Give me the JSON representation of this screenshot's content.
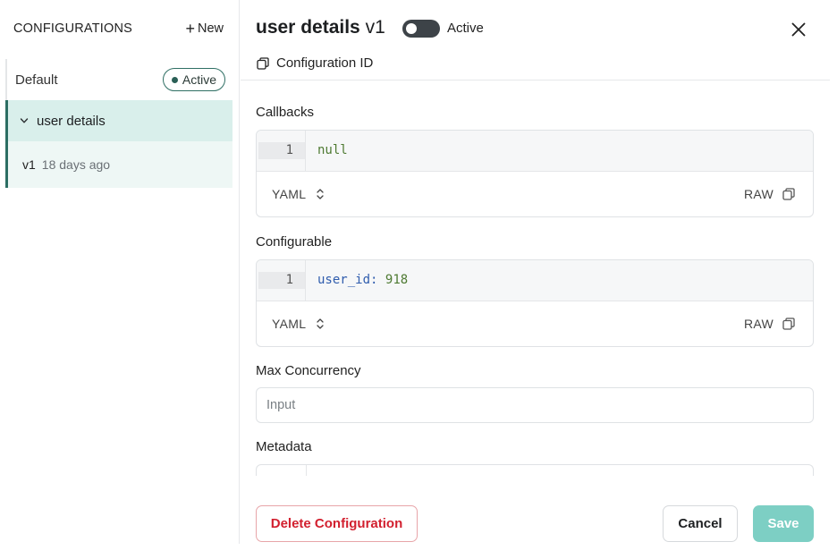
{
  "sidebar": {
    "title": "CONFIGURATIONS",
    "new_label": "New",
    "default_label": "Default",
    "default_badge": "Active",
    "selected_label": "user details",
    "version_label": "v1",
    "version_age": "18 days ago"
  },
  "header": {
    "title": "user details",
    "version": "v1",
    "toggle_label": "Active",
    "config_id_label": "Configuration ID"
  },
  "sections": {
    "callbacks": {
      "label": "Callbacks",
      "line_number": "1",
      "code_value": "null",
      "format": "YAML",
      "raw_label": "RAW"
    },
    "configurable": {
      "label": "Configurable",
      "line_number": "1",
      "code_key": "user_id",
      "code_colon": ":",
      "code_value": "918",
      "format": "YAML",
      "raw_label": "RAW"
    },
    "max_concurrency": {
      "label": "Max Concurrency",
      "placeholder": "Input"
    },
    "metadata": {
      "label": "Metadata"
    }
  },
  "footer": {
    "delete_label": "Delete Configuration",
    "cancel_label": "Cancel",
    "save_label": "Save"
  },
  "colors": {
    "accent": "#2c6e63",
    "selected_bg": "#d9efeb",
    "danger": "#d2202f",
    "save_disabled": "#7dcfc4"
  }
}
